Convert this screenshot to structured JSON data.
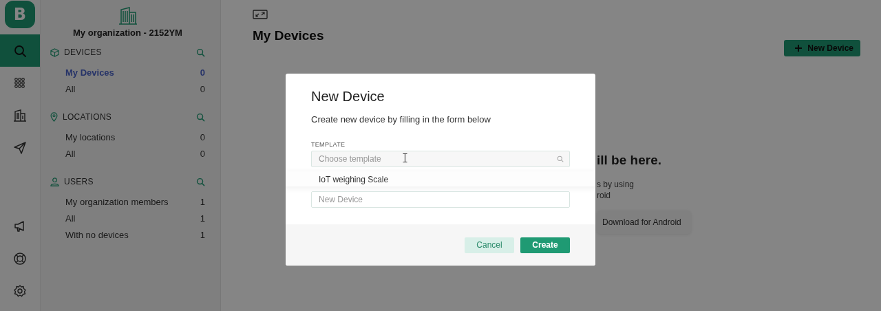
{
  "rail": {
    "logo": "B",
    "items": [
      {
        "kind": "search",
        "selected": true
      },
      {
        "kind": "grid",
        "selected": false
      },
      {
        "kind": "building",
        "selected": false
      },
      {
        "kind": "send",
        "selected": false
      }
    ],
    "bottom_items": [
      {
        "kind": "megaphone"
      },
      {
        "kind": "lifebuoy"
      },
      {
        "kind": "settings"
      }
    ]
  },
  "sidebar": {
    "organization": "My organization - 2152YM",
    "sections": [
      {
        "kind": "devices",
        "title": "DEVICES",
        "items": [
          {
            "label": "My Devices",
            "count": "0",
            "selected": true
          },
          {
            "label": "All",
            "count": "0",
            "selected": false
          }
        ]
      },
      {
        "kind": "locations",
        "title": "LOCATIONS",
        "items": [
          {
            "label": "My locations",
            "count": "0",
            "selected": false
          },
          {
            "label": "All",
            "count": "0",
            "selected": false
          }
        ]
      },
      {
        "kind": "users",
        "title": "USERS",
        "items": [
          {
            "label": "My organization members",
            "count": "1",
            "selected": false
          },
          {
            "label": "All",
            "count": "1",
            "selected": false
          },
          {
            "label": "With no devices",
            "count": "1",
            "selected": false
          }
        ]
      }
    ]
  },
  "main": {
    "title": "My Devices",
    "new_button": "New Device",
    "empty_heading": "ill be here.",
    "empty_text": [
      "s by using",
      "roid"
    ],
    "download_button": "Download for Android"
  },
  "modal": {
    "title": "New Device",
    "subtitle": "Create new device by filling in the form below",
    "template_label": "TEMPLATE",
    "template_field": {
      "placeholder": "Choose template"
    },
    "options": [
      "IoT weighing Scale"
    ],
    "name_field": {
      "placeholder": "New Device"
    },
    "cancel": "Cancel",
    "create": "Create"
  }
}
